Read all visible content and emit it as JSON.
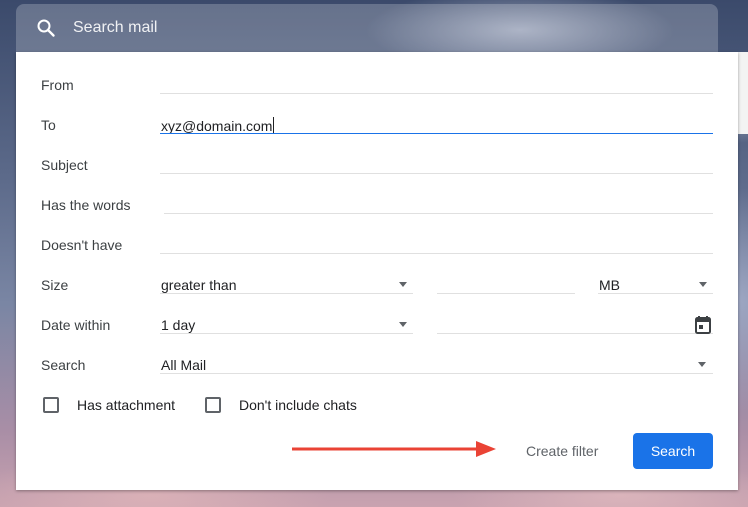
{
  "search": {
    "placeholder": "Search mail"
  },
  "fields": {
    "from": {
      "label": "From",
      "value": ""
    },
    "to": {
      "label": "To",
      "value": "xyz@domain.com"
    },
    "subject": {
      "label": "Subject",
      "value": ""
    },
    "has_words": {
      "label": "Has the words",
      "value": ""
    },
    "doesnt_have": {
      "label": "Doesn't have",
      "value": ""
    },
    "size": {
      "label": "Size",
      "operator": "greater than",
      "amount": "",
      "unit": "MB"
    },
    "date_within": {
      "label": "Date within",
      "value": "1 day",
      "date": ""
    },
    "search_in": {
      "label": "Search",
      "value": "All Mail"
    }
  },
  "checkboxes": {
    "has_attachment": {
      "label": "Has attachment",
      "checked": false
    },
    "exclude_chats": {
      "label": "Don't include chats",
      "checked": false
    }
  },
  "actions": {
    "create_filter": "Create filter",
    "search": "Search"
  },
  "colors": {
    "accent": "#1a73e8",
    "annotation_arrow": "#ea4335"
  },
  "icons": [
    "search-icon",
    "dropdown-arrow-icon",
    "calendar-icon",
    "arrow-annotation-icon"
  ]
}
